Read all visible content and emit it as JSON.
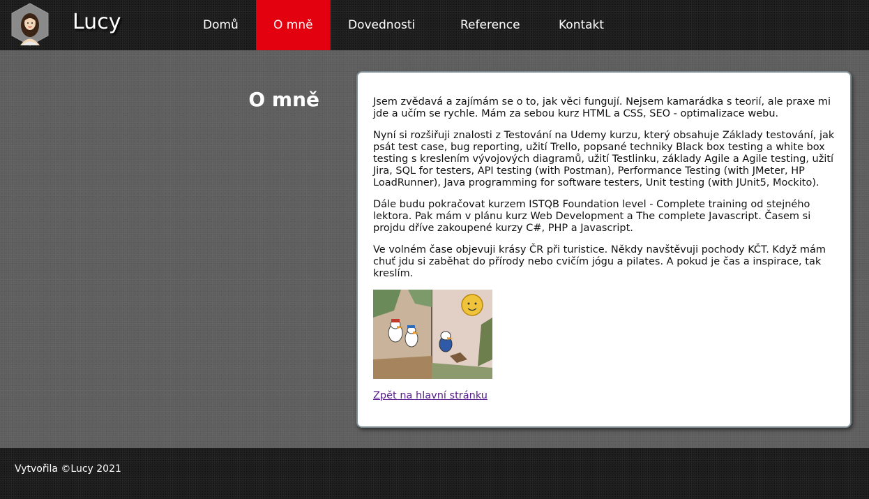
{
  "header": {
    "brand": "Lucy",
    "nav": [
      {
        "label": "Domů",
        "active": false
      },
      {
        "label": "O mně",
        "active": true
      },
      {
        "label": "Dovednosti",
        "active": false
      },
      {
        "label": "Reference",
        "active": false
      },
      {
        "label": "Kontakt",
        "active": false
      }
    ],
    "active_color": "#e3000f"
  },
  "main": {
    "title": "O mně",
    "paragraphs": [
      "Jsem zvědavá a zajímám se o to, jak věci fungují. Nejsem kamarádka s teorií, ale praxe mi jde a učím se rychle. Mám za sebou kurz HTML a CSS, SEO - optimalizace webu.",
      "Nyní si rozšiřuji znalosti z Testování na Udemy kurzu, který obsahuje Základy testování, jak psát test case, bug reporting, užití Trello, popsané techniky Black box testing a white box testing s kreslením vývojových diagramů, užití Testlinku, základy Agile a Agile testing, užití Jira, SQL for testers, API testing (with Postman), Performance Testing (with JMeter, HP LoadRunner), Java programming for software testers, Unit testing (with JUnit5, Mockito).",
      "Dále budu pokračovat kurzem ISTQB Foundation level - Complete training od stejného lektora. Pak mám v plánu kurz Web Development a The complete Javascript. Časem si projdu dříve zakoupené kurzy C#, PHP a Javascript.",
      "Ve volném čase objevuji krásy ČR při turistice. Někdy navštěvuji pochody KČT. Když mám chuť jdu si zaběhat do přírody nebo cvičím jógu a pilates. A pokud je čas a inspirace, tak kreslím."
    ],
    "back_link": "Zpět na hlavní stránku"
  },
  "footer": {
    "text": "Vytvořila ©Lucy 2021"
  }
}
